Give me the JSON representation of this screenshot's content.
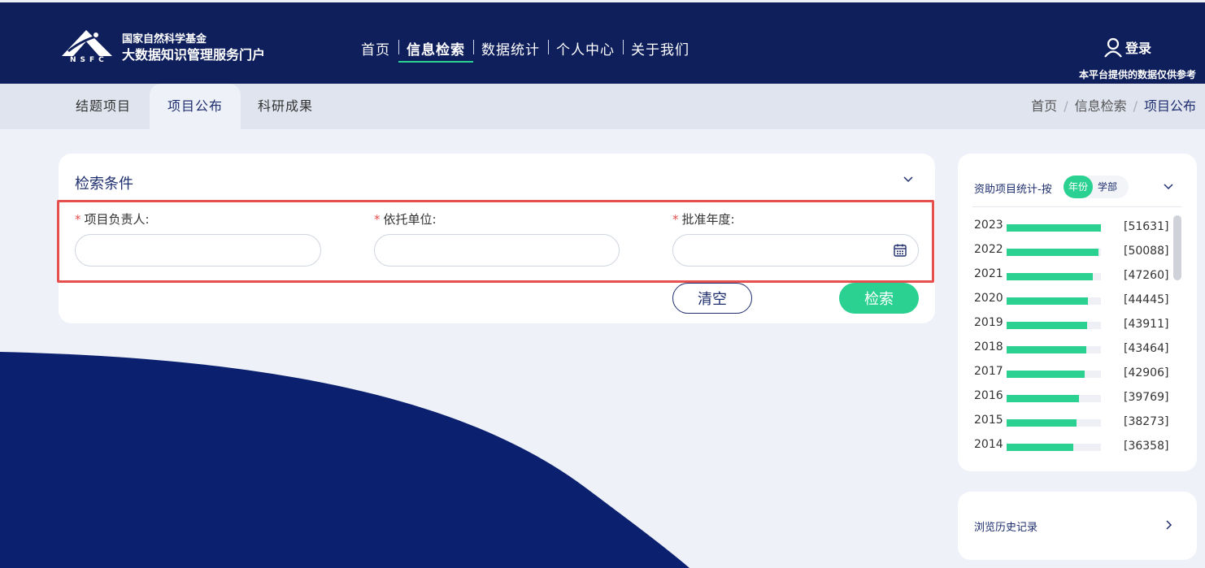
{
  "header": {
    "logo_line1": "国家自然科学基金",
    "logo_line2": "大数据知识管理服务门户",
    "logo_abbr": "NSFC",
    "nav": [
      {
        "label": "首页",
        "active": false
      },
      {
        "label": "信息检索",
        "active": true
      },
      {
        "label": "数据统计",
        "active": false
      },
      {
        "label": "个人中心",
        "active": false
      },
      {
        "label": "关于我们",
        "active": false
      }
    ],
    "login_label": "登录",
    "note": "本平台提供的数据仅供参考"
  },
  "subnav": {
    "tabs": [
      {
        "label": "结题项目",
        "active": false
      },
      {
        "label": "项目公布",
        "active": true
      },
      {
        "label": "科研成果",
        "active": false
      }
    ],
    "breadcrumb": [
      "首页",
      "信息检索",
      "项目公布"
    ]
  },
  "search": {
    "title": "检索条件",
    "fields": [
      {
        "label": "项目负责人:",
        "value": "",
        "required": true
      },
      {
        "label": "依托单位:",
        "value": "",
        "required": true
      },
      {
        "label": "批准年度:",
        "value": "",
        "required": true
      }
    ],
    "required_mark": "*",
    "clear_label": "清空",
    "search_label": "检索"
  },
  "stats": {
    "title": "资助项目统计-按",
    "toggle": [
      {
        "label": "年份",
        "active": true
      },
      {
        "label": "学部",
        "active": false
      }
    ],
    "max": 51631,
    "rows": [
      {
        "year": "2023",
        "count": 51631,
        "count_label": "[51631]"
      },
      {
        "year": "2022",
        "count": 50088,
        "count_label": "[50088]"
      },
      {
        "year": "2021",
        "count": 47260,
        "count_label": "[47260]"
      },
      {
        "year": "2020",
        "count": 44445,
        "count_label": "[44445]"
      },
      {
        "year": "2019",
        "count": 43911,
        "count_label": "[43911]"
      },
      {
        "year": "2018",
        "count": 43464,
        "count_label": "[43464]"
      },
      {
        "year": "2017",
        "count": 42906,
        "count_label": "[42906]"
      },
      {
        "year": "2016",
        "count": 39769,
        "count_label": "[39769]"
      },
      {
        "year": "2015",
        "count": 38273,
        "count_label": "[38273]"
      },
      {
        "year": "2014",
        "count": 36358,
        "count_label": "[36358]"
      }
    ]
  },
  "history": {
    "label": "浏览历史记录"
  },
  "colors": {
    "header_bg": "#0f1f5c",
    "accent_green": "#2bd190",
    "navy": "#1e2e6e",
    "wave": "#0b2170",
    "required_red": "#e5504f"
  }
}
